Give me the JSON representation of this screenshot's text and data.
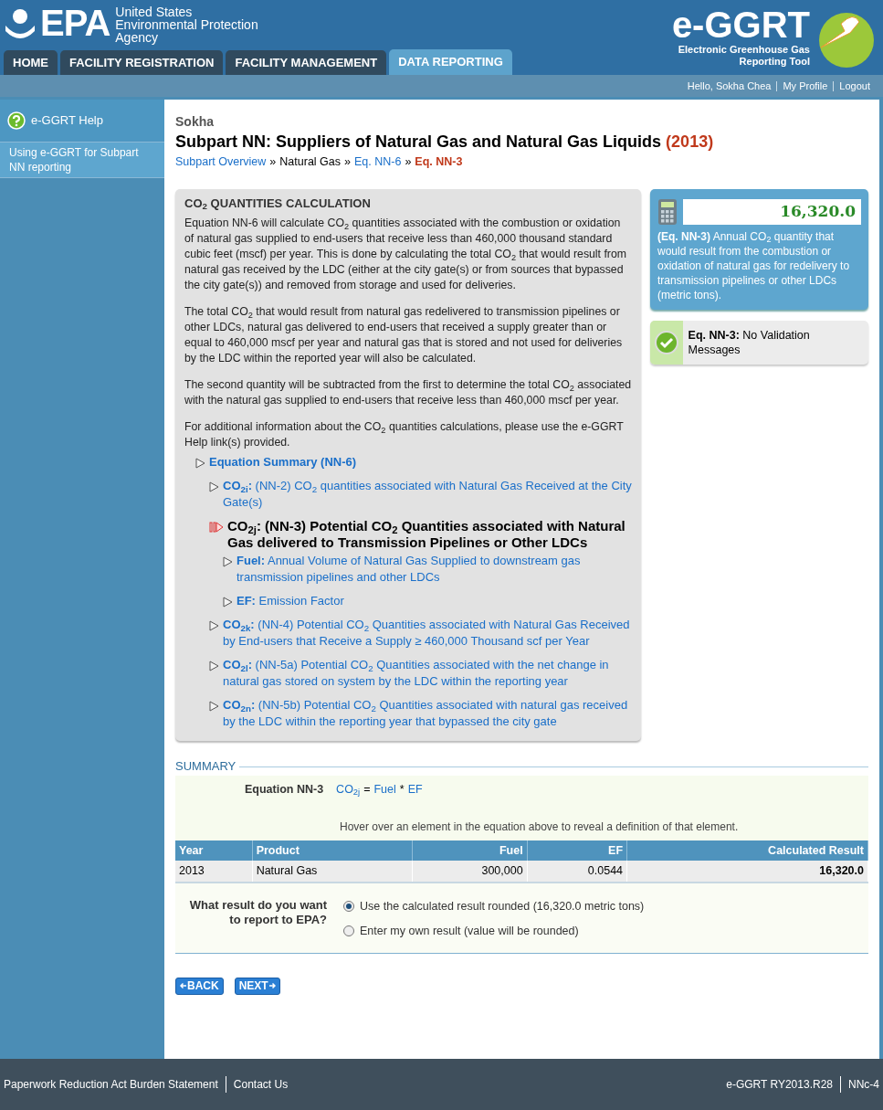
{
  "header": {
    "logo_text": "EPA",
    "agency_lines": [
      "United States",
      "Environmental Protection",
      "Agency"
    ],
    "app_logo": "e-GGRT",
    "app_subtitle_lines": [
      "Electronic Greenhouse Gas",
      "Reporting Tool"
    ]
  },
  "tabs": [
    {
      "label": "HOME",
      "selected": false
    },
    {
      "label": "FACILITY REGISTRATION",
      "selected": false
    },
    {
      "label": "FACILITY MANAGEMENT",
      "selected": false
    },
    {
      "label": "DATA REPORTING",
      "selected": true
    }
  ],
  "user_links": [
    "Hello, Sokha Chea",
    "My Profile",
    "Logout"
  ],
  "sidebar": {
    "help_title": "e-GGRT Help",
    "items": [
      {
        "label": "Using e-GGRT for Subpart NN reporting"
      }
    ]
  },
  "facility": "Sokha",
  "title": {
    "text": "Subpart NN: Suppliers of Natural Gas and Natural Gas Liquids",
    "year": "(2013)"
  },
  "breadcrumb": [
    {
      "label": "Subpart Overview",
      "kind": "link"
    },
    {
      "label": "»",
      "kind": "separator"
    },
    {
      "label": "Natural Gas",
      "kind": "plain"
    },
    {
      "label": "»",
      "kind": "separator"
    },
    {
      "label": "Eq. NN-6",
      "kind": "link"
    },
    {
      "label": "»",
      "kind": "separator"
    },
    {
      "label": "Eq. NN-3",
      "kind": "current"
    }
  ],
  "info_panel": {
    "heading": "CO$_{2}$ QUANTITIES CALCULATION",
    "paragraphs": [
      "Equation NN-6 will calculate CO$_{2}$ quantities associated with the combustion or oxidation of natural gas supplied to end-users that receive less than 460,000 thousand standard cubic feet (mscf) per year. This is done by calculating the total CO$_{2}$ that would result from natural gas received by the LDC (either at the city gate(s) or from sources that bypassed the city gate(s)) and removed from storage and used for deliveries.",
      "The total CO$_{2}$ that would result from natural gas redelivered to transmission pipelines or other LDCs, natural gas delivered to end-users that received a supply greater than or equal to 460,000 mscf per year and natural gas that is stored and not used for deliveries by the LDC within the reported year will also be calculated.",
      "The second quantity will be subtracted from the first to determine the total CO$_{2}$ associated with the natural gas supplied to end-users that receive less than 460,000 mscf per year.",
      "For additional information about the CO$_{2}$ quantities calculations, please use the e-GGRT Help link(s) provided."
    ],
    "tree": [
      {
        "term": "Equation Summary (NN-6)",
        "selected": false,
        "children": [
          {
            "term": "CO$_{2i}$:",
            "text": "(NN-2) CO$_{2}$ quantities associated with Natural Gas Received at the City Gate(s)",
            "selected": false
          },
          {
            "term": "CO$_{2j}$:",
            "text": "(NN-3) Potential CO$_{2}$ Quantities associated with Natural Gas delivered to Transmission Pipelines or Other LDCs",
            "selected": true,
            "children": [
              {
                "term": "Fuel:",
                "text": "Annual Volume of Natural Gas Supplied to downstream gas transmission pipelines and other LDCs",
                "selected": false
              },
              {
                "term": "EF:",
                "text": "Emission Factor",
                "selected": false
              }
            ]
          },
          {
            "term": "CO$_{2k}$:",
            "text": "(NN-4) Potential CO$_{2}$ Quantities associated with Natural Gas Received by End-users that Receive a Supply ≥ 460,000 Thousand scf per Year",
            "selected": false
          },
          {
            "term": "CO$_{2l}$:",
            "text": "(NN-5a) Potential CO$_{2}$ Quantities associated with the net change in natural gas stored on system by the LDC within the reporting year",
            "selected": false
          },
          {
            "term": "CO$_{2n}$:",
            "text": "(NN-5b) Potential CO$_{2}$ Quantities associated with natural gas received by the LDC within the reporting year that bypassed the city gate",
            "selected": false
          }
        ]
      }
    ]
  },
  "result_card": {
    "value": "16,320.0",
    "label": "(Eq. NN-3)",
    "description": "Annual CO$_{2}$ quantity that would result from the combustion or oxidation of natural gas for redelivery to transmission pipelines or other LDCs (metric tons)."
  },
  "validation": {
    "label": "Eq. NN-3:",
    "message": "No Validation Messages"
  },
  "summary": {
    "heading": "SUMMARY",
    "equation_label": "Equation NN-3",
    "equation": [
      {
        "text": "CO$_{2j}$",
        "kind": "term"
      },
      {
        "text": "=",
        "kind": "operator"
      },
      {
        "text": "Fuel",
        "kind": "term"
      },
      {
        "text": "*",
        "kind": "operator"
      },
      {
        "text": "EF",
        "kind": "term"
      }
    ],
    "hint": "Hover over an element in the equation above to reveal a definition of that element."
  },
  "table": {
    "columns": [
      {
        "label": "Year",
        "kind": "text"
      },
      {
        "label": "Product",
        "kind": "text"
      },
      {
        "label": "Fuel",
        "kind": "number"
      },
      {
        "label": "EF",
        "kind": "number"
      },
      {
        "label": "Calculated Result",
        "kind": "total"
      }
    ],
    "rows": [
      [
        "2013",
        "Natural Gas",
        "300,000",
        "0.0544",
        "16,320.0"
      ]
    ]
  },
  "report_question": {
    "label": "What result do you want to report to EPA?",
    "options": [
      {
        "label": "Use the calculated result rounded (16,320.0 metric tons)",
        "selected": true
      },
      {
        "label": "Enter my own result (value will be rounded)",
        "selected": false
      }
    ]
  },
  "buttons": [
    {
      "label": "BACK",
      "kind": "back"
    },
    {
      "label": "NEXT",
      "kind": "next"
    }
  ],
  "footer": {
    "links": [
      "Paperwork Reduction Act Burden Statement",
      "Contact Us"
    ],
    "version": [
      "e-GGRT RY2013.R28",
      "NNc-4"
    ]
  }
}
